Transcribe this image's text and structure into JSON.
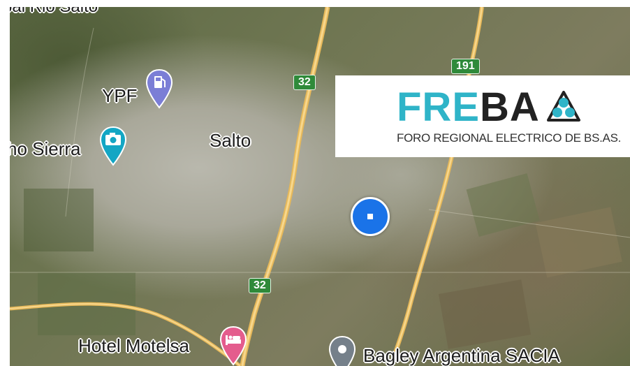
{
  "map": {
    "labels": {
      "top_cut": "pal Rio Salto",
      "ypf": "YPF",
      "salto": "Salto",
      "sierra": "ho Sierra",
      "hotel": "Hotel Motelsa",
      "bagley": "Bagley Argentina SACIA"
    },
    "shields": {
      "route_32_top": "32",
      "route_32_bottom": "32",
      "route_191": "191"
    },
    "icons": {
      "ypf": "fuel-pump-icon",
      "sierra": "camera-icon",
      "hotel": "bed-icon",
      "bagley": "place-pin-icon",
      "location": "my-location-icon"
    },
    "colors": {
      "fuel_pin": "#7b7ed6",
      "camera_pin": "#13a6c4",
      "hotel_pin": "#e45c8d",
      "place_pin": "#75808a",
      "location": "#1a73e8",
      "route_shield": "#2f8a3a",
      "road": "#f2c86a"
    }
  },
  "logo": {
    "word_part1": "FRE",
    "word_part2": "BA",
    "subtitle": "FORO REGIONAL ELECTRICO DE BS.AS.",
    "accent": "#2fb4c8"
  }
}
